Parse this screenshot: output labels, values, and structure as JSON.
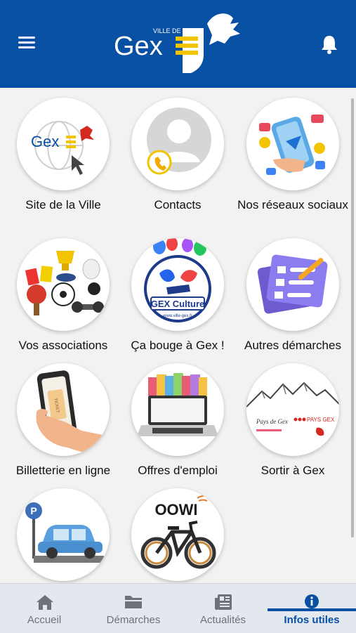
{
  "header": {
    "logo": {
      "ville_de": "VILLE DE",
      "name": "Gex"
    }
  },
  "tiles": [
    {
      "label": "Site de la Ville",
      "image_text": "Gex"
    },
    {
      "label": "Contacts"
    },
    {
      "label": "Nos réseaux sociaux"
    },
    {
      "label": "Vos associations"
    },
    {
      "label": "Ça bouge à Gex !",
      "image_text": "GEX Culture",
      "image_subtext": "www.ville-gex.fr"
    },
    {
      "label": "Autres démarches"
    },
    {
      "label": "Billetterie en ligne",
      "image_text": "TICKET"
    },
    {
      "label": "Offres d'emploi"
    },
    {
      "label": "Sortir à Gex",
      "image_text": "PAYS GEX",
      "image_subtext": "Pays de Gex"
    },
    {
      "label": "",
      "image_text": "P"
    },
    {
      "label": "",
      "image_text": "OOWI"
    }
  ],
  "tabbar": {
    "items": [
      {
        "label": "Accueil",
        "icon": "home-icon"
      },
      {
        "label": "Démarches",
        "icon": "folder-icon"
      },
      {
        "label": "Actualités",
        "icon": "newspaper-icon"
      },
      {
        "label": "Infos utiles",
        "icon": "info-icon"
      }
    ],
    "active": "Infos utiles"
  },
  "colors": {
    "brand_blue": "#0750a4",
    "logo_yellow": "#f2c400",
    "background": "#f2f2f2"
  }
}
